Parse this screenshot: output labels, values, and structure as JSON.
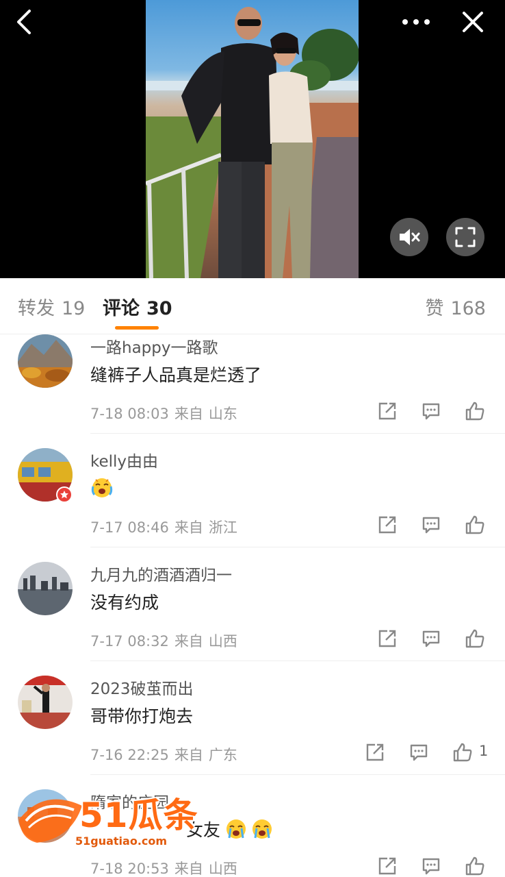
{
  "media": {
    "icons": [
      "back-icon",
      "more-icon",
      "close-icon",
      "mute-icon",
      "fullscreen-icon"
    ]
  },
  "tabs": {
    "repost": {
      "label": "转发",
      "count": "19"
    },
    "comment": {
      "label": "评论",
      "count": "30"
    },
    "like": {
      "label": "赞",
      "count": "168"
    }
  },
  "comments": [
    {
      "user": "一路happy一路歌",
      "text": "缝裤子人品真是烂透了",
      "time": "7-18 08:03",
      "from": "来自",
      "location": "山东",
      "likes": ""
    },
    {
      "user": "kelly由由",
      "text": "",
      "emoji": "crying-emoji",
      "time": "7-17 08:46",
      "from": "来自",
      "location": "浙江",
      "likes": ""
    },
    {
      "user": "九月九的酒酒酒归一",
      "text": "没有约成",
      "time": "7-17 08:32",
      "from": "来自",
      "location": "山西",
      "likes": ""
    },
    {
      "user": "2023破茧而出",
      "text": "哥带你打炮去",
      "time": "7-16 22:25",
      "from": "来自",
      "location": "广东",
      "likes": "1"
    },
    {
      "user": "隋家的庄园",
      "text": "女友",
      "time": "7-18 20:53",
      "from": "来自",
      "location": "山西",
      "likes": ""
    }
  ],
  "watermark": {
    "brand": "51瓜条",
    "url": "51guatiao.com"
  },
  "colors": {
    "accent": "#ff8200",
    "background_media": "#000000"
  }
}
